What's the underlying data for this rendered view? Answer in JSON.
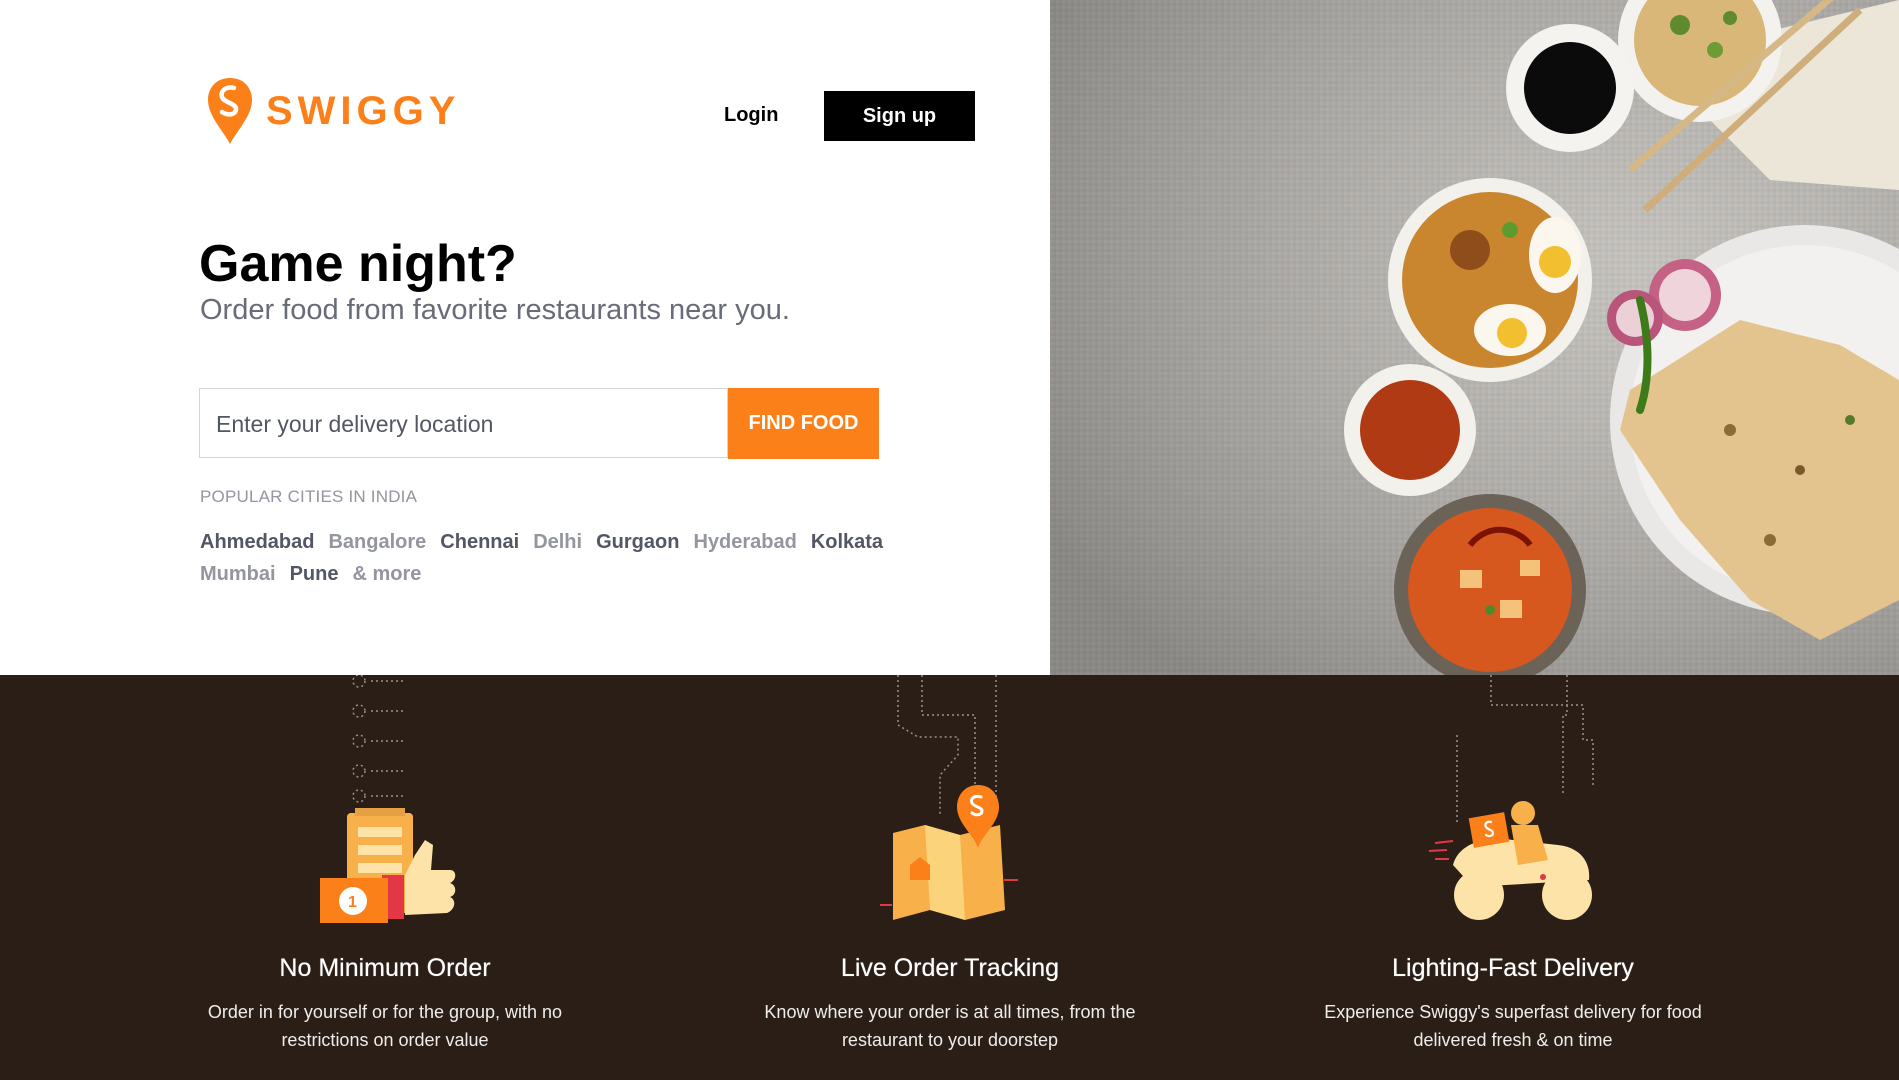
{
  "brand": {
    "name": "SWIGGY",
    "color": "#fc8019"
  },
  "header": {
    "login_label": "Login",
    "signup_label": "Sign up"
  },
  "hero": {
    "headline": "Game night?",
    "subline": "Order food from favorite restaurants near you."
  },
  "search": {
    "placeholder": "Enter your delivery location",
    "button_label": "FIND FOOD"
  },
  "popular_cities": {
    "title": "POPULAR CITIES IN INDIA",
    "cities": [
      {
        "label": "Ahmedabad",
        "tone": "dark"
      },
      {
        "label": "Bangalore",
        "tone": "light"
      },
      {
        "label": "Chennai",
        "tone": "dark"
      },
      {
        "label": "Delhi",
        "tone": "light"
      },
      {
        "label": "Gurgaon",
        "tone": "dark"
      },
      {
        "label": "Hyderabad",
        "tone": "light"
      },
      {
        "label": "Kolkata",
        "tone": "dark"
      },
      {
        "label": "Mumbai",
        "tone": "light"
      },
      {
        "label": "Pune",
        "tone": "dark"
      },
      {
        "label": "& more",
        "tone": "light"
      }
    ]
  },
  "features": [
    {
      "title": "No Minimum Order",
      "description": "Order in for yourself or for the group, with no restrictions on order value",
      "icon": "thumbs-up-order-icon"
    },
    {
      "title": "Live Order Tracking",
      "description": "Know where your order is at all times, from the restaurant to your doorstep",
      "icon": "map-location-pin-icon"
    },
    {
      "title": "Lighting-Fast Delivery",
      "description": "Experience Swiggy's superfast delivery for food delivered fresh & on time",
      "icon": "delivery-scooter-icon"
    }
  ],
  "colors": {
    "accent": "#fc8019",
    "footer_bg": "#2b1e16",
    "text_muted": "#686b78"
  }
}
